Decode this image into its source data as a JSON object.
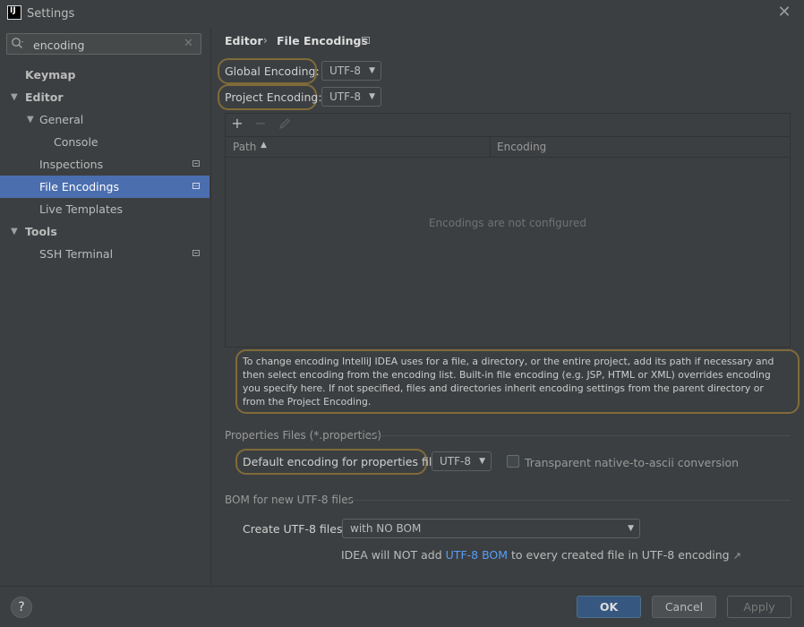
{
  "window": {
    "title": "Settings",
    "logo": "IJ"
  },
  "search": {
    "value": "encoding"
  },
  "sidebar": {
    "items": [
      {
        "label": "Keymap"
      },
      {
        "label": "Editor"
      },
      {
        "label": "General"
      },
      {
        "label": "Console"
      },
      {
        "label": "Inspections"
      },
      {
        "label": "File Encodings"
      },
      {
        "label": "Live Templates"
      },
      {
        "label": "Tools"
      },
      {
        "label": "SSH Terminal"
      }
    ]
  },
  "breadcrumb": {
    "parent": "Editor",
    "separator": "›",
    "current": "File Encodings"
  },
  "encodings": {
    "global_label": "Global Encoding:",
    "global_value": "UTF-8",
    "project_label": "Project Encoding:",
    "project_value": "UTF-8"
  },
  "table": {
    "col_path": "Path",
    "col_encoding": "Encoding",
    "empty": "Encodings are not configured"
  },
  "info": {
    "text": "To change encoding IntelliJ IDEA uses for a file, a directory, or the entire project, add its path if necessary and then select encoding from the encoding list. Built-in file encoding (e.g. JSP, HTML or XML) overrides encoding you specify here. If not specified, files and directories inherit encoding settings from the parent directory or from the Project Encoding."
  },
  "properties": {
    "section_title": "Properties Files (*.properties)",
    "default_label": "Default encoding for properties files:",
    "default_value": "UTF-8",
    "checkbox_label": "Transparent native-to-ascii conversion",
    "checkbox_checked": false
  },
  "bom": {
    "section_title": "BOM for new UTF-8 files",
    "create_label": "Create UTF-8 files:",
    "create_value": "with NO BOM",
    "hint_prefix": "IDEA will NOT add ",
    "hint_link": "UTF-8 BOM",
    "hint_suffix": " to every created file in UTF-8 encoding",
    "ext_icon": "↗"
  },
  "buttons": {
    "help": "?",
    "ok": "OK",
    "cancel": "Cancel",
    "apply": "Apply"
  },
  "colors": {
    "selection": "#4b6eaf",
    "link": "#589df6",
    "highlight": "#806b3a"
  }
}
